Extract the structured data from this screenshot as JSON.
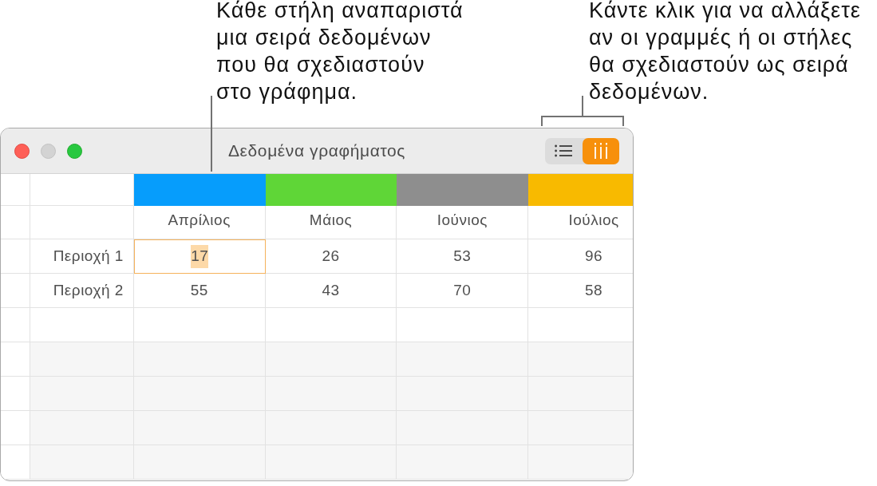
{
  "callouts": [
    {
      "kind": "line",
      "lines": [
        "Κάθε στήλη αναπαριστά",
        "μια σειρά δεδομένων",
        "που θα σχεδιαστούν",
        "στο γράφημα."
      ]
    },
    {
      "kind": "bracket",
      "lines": [
        "Κάντε κλικ για να αλλάξετε",
        "αν οι γραμμές ή οι στήλες",
        "θα σχεδιαστούν ως σειρά",
        "δεδομένων."
      ]
    }
  ],
  "window": {
    "title": "Δεδομένα γραφήματος",
    "controls": [
      {
        "kind": "close",
        "disabled": false
      },
      {
        "kind": "minimize",
        "disabled": true
      },
      {
        "kind": "zoom",
        "disabled": false
      }
    ]
  },
  "series_toggle": [
    {
      "kind": "rows",
      "selected": false
    },
    {
      "kind": "columns",
      "selected": true
    }
  ],
  "table": {
    "columns": [
      {
        "name": "Απρίλιος",
        "color": "#069dfc"
      },
      {
        "name": "Μάιος",
        "color": "#5fd637"
      },
      {
        "name": "Ιούνιος",
        "color": "#8e8e8e"
      },
      {
        "name": "Ιούλιος",
        "color": "#f8ba00"
      }
    ],
    "rows": [
      {
        "label": "Περιοχή 1",
        "cells": [
          {
            "value": "17",
            "selected": true
          },
          {
            "value": "26",
            "selected": false
          },
          {
            "value": "53",
            "selected": false
          },
          {
            "value": "96",
            "selected": false
          }
        ]
      },
      {
        "label": "Περιοχή 2",
        "cells": [
          {
            "value": "55",
            "selected": false
          },
          {
            "value": "43",
            "selected": false
          },
          {
            "value": "70",
            "selected": false
          },
          {
            "value": "58",
            "selected": false
          }
        ]
      }
    ]
  }
}
